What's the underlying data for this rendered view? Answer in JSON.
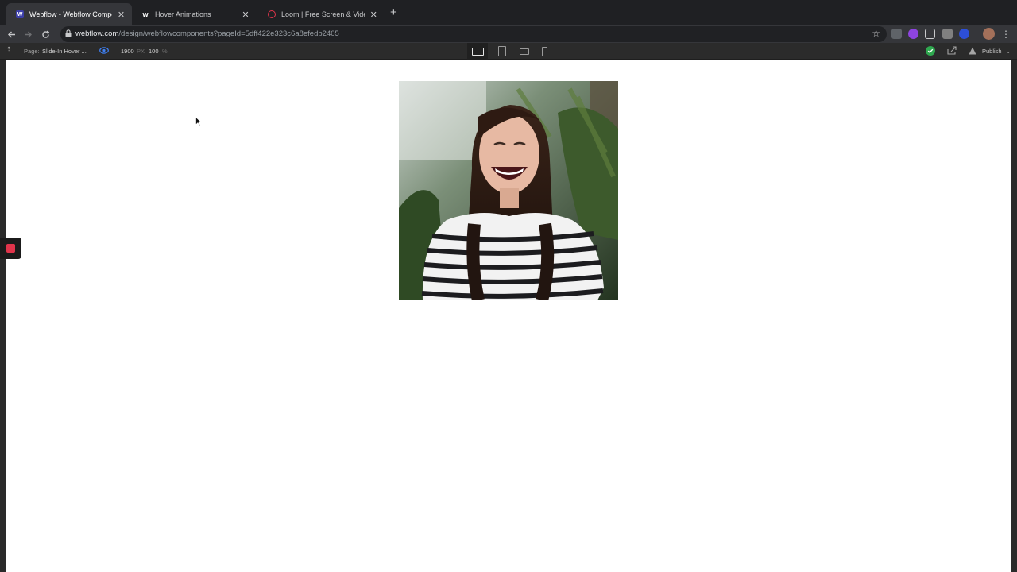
{
  "browser": {
    "tabs": [
      {
        "title": "Webflow - Webflow Components",
        "active": true,
        "favicon": "webflow-icon"
      },
      {
        "title": "Hover Animations",
        "active": false,
        "favicon": "webflow-w-icon"
      },
      {
        "title": "Loom | Free Screen & Video Recording",
        "active": false,
        "favicon": "loom-icon"
      }
    ],
    "url_host": "webflow.com",
    "url_path": "/design/webflowcomponents?pageId=5dff422e323c6a8efedb2405"
  },
  "designer": {
    "page_label": "Page:",
    "page_name": "Slide-In Hover ...",
    "canvas_width": "1900",
    "width_unit": "PX",
    "zoom": "100",
    "zoom_unit": "%",
    "publish_label": "Publish",
    "devices": [
      "desktop",
      "tablet",
      "mobile-landscape",
      "mobile-portrait"
    ],
    "active_device": "desktop"
  },
  "colors": {
    "tab_strip": "#1f2023",
    "active_tab": "#35363a",
    "designer_bar": "#2b2b2b",
    "record_red": "#e0344b",
    "status_green": "#2fa84f"
  }
}
